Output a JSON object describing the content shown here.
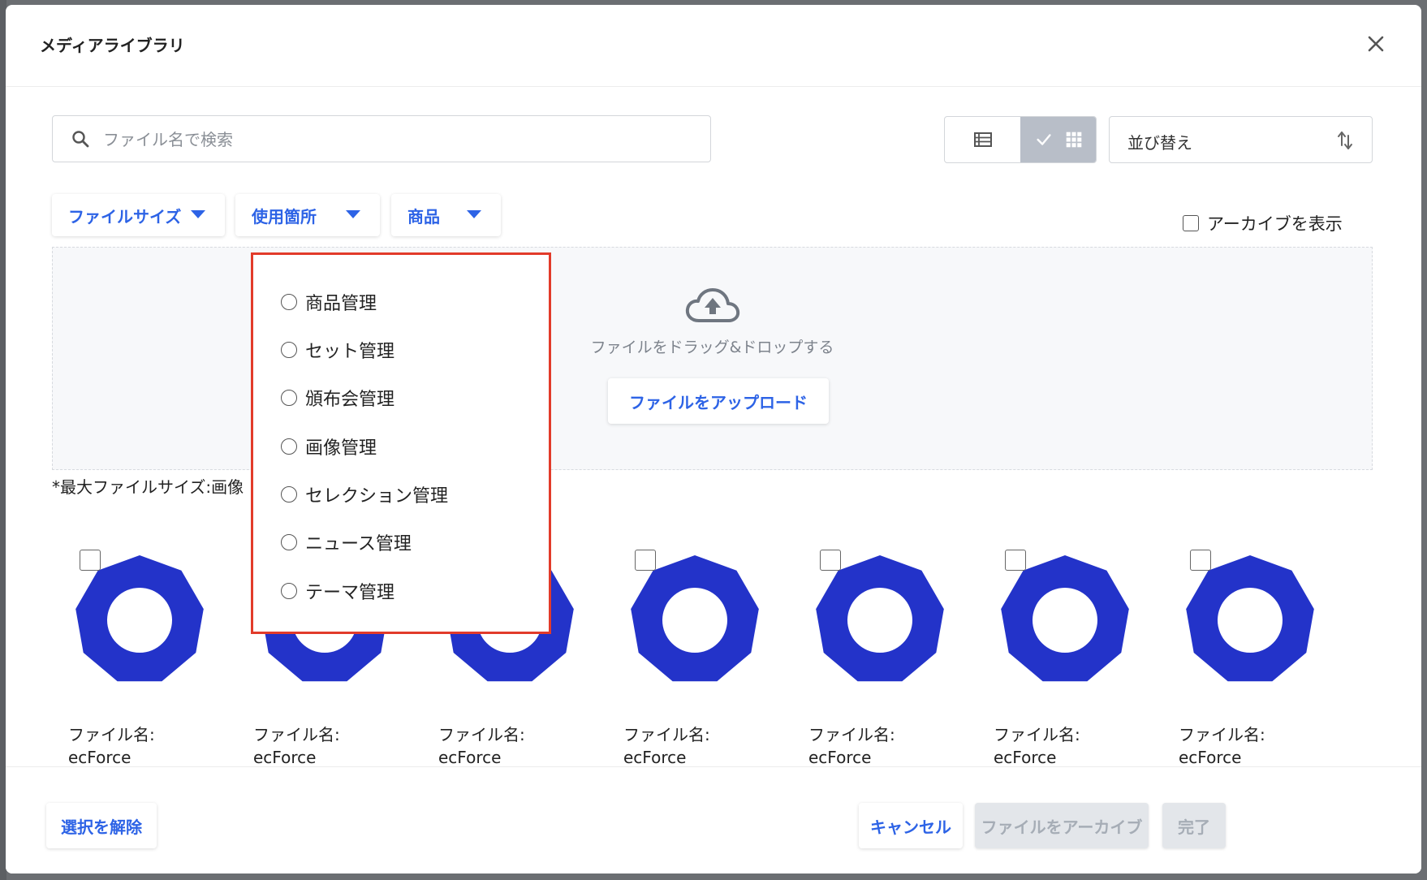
{
  "modal": {
    "title": "メディアライブラリ",
    "close_icon": "close-icon"
  },
  "search": {
    "placeholder": "ファイル名で検索",
    "value": ""
  },
  "view_toggle": {
    "options": [
      "list-view-icon",
      "grid-view-icon"
    ],
    "selected": "grid"
  },
  "sort": {
    "label": "並び替え"
  },
  "filters": [
    {
      "label": "ファイルサイズ"
    },
    {
      "label": "使用箇所"
    },
    {
      "label": "商品"
    }
  ],
  "archive_toggle": {
    "label": "アーカイブを表示",
    "checked": false
  },
  "dropzone": {
    "hint": "ファイルをドラッグ&ドロップする",
    "upload_label": "ファイルをアップロード"
  },
  "note": "*最大ファイルサイズ:画像",
  "usage_dropdown": {
    "options": [
      "商品管理",
      "セット管理",
      "頒布会管理",
      "画像管理",
      "セレクション管理",
      "ニュース管理",
      "テーマ管理"
    ]
  },
  "files": [
    {
      "label": "ファイル名:",
      "name": "ecForce"
    },
    {
      "label": "ファイル名:",
      "name": "ecForce"
    },
    {
      "label": "ファイル名:",
      "name": "ecForce"
    },
    {
      "label": "ファイル名:",
      "name": "ecForce"
    },
    {
      "label": "ファイル名:",
      "name": "ecForce"
    },
    {
      "label": "ファイル名:",
      "name": "ecForce"
    },
    {
      "label": "ファイル名:",
      "name": "ecForce"
    }
  ],
  "footer": {
    "deselect_label": "選択を解除",
    "cancel_label": "キャンセル",
    "archive_label": "ファイルをアーカイブ",
    "done_label": "完了"
  },
  "colors": {
    "accent": "#2d63e6",
    "thumbnail": "#2333c9",
    "highlight_border": "#e23b2a"
  }
}
